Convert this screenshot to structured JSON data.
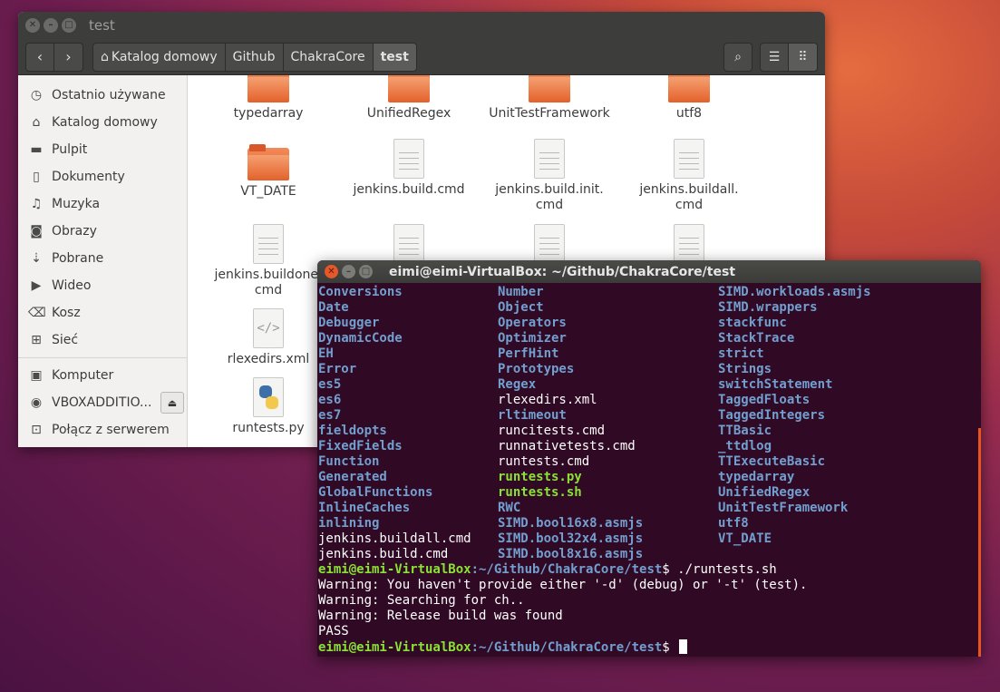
{
  "file_manager": {
    "title": "test",
    "breadcrumbs": [
      "Katalog domowy",
      "Github",
      "ChakraCore",
      "test"
    ],
    "sidebar": [
      {
        "label": "Ostatnio używane",
        "icon": "clock-icon"
      },
      {
        "label": "Katalog domowy",
        "icon": "home-icon"
      },
      {
        "label": "Pulpit",
        "icon": "folder-icon"
      },
      {
        "label": "Dokumenty",
        "icon": "document-icon"
      },
      {
        "label": "Muzyka",
        "icon": "music-icon"
      },
      {
        "label": "Obrazy",
        "icon": "camera-icon"
      },
      {
        "label": "Pobrane",
        "icon": "download-icon"
      },
      {
        "label": "Wideo",
        "icon": "video-icon"
      },
      {
        "label": "Kosz",
        "icon": "trash-icon"
      },
      {
        "label": "Sieć",
        "icon": "network-icon"
      },
      {
        "label": "Komputer",
        "icon": "computer-icon"
      },
      {
        "label": "VBOXADDITIO...",
        "icon": "disc-icon"
      },
      {
        "label": "Połącz z serwerem",
        "icon": "server-icon"
      }
    ],
    "files": [
      {
        "name": "typedarray",
        "type": "folder"
      },
      {
        "name": "UnifiedRegex",
        "type": "folder"
      },
      {
        "name": "UnitTestFramework",
        "type": "folder"
      },
      {
        "name": "utf8",
        "type": "folder"
      },
      {
        "name": "VT_DATE",
        "type": "folder"
      },
      {
        "name": "jenkins.build.cmd",
        "type": "text"
      },
      {
        "name": "jenkins.build.init.\ncmd",
        "type": "text"
      },
      {
        "name": "jenkins.buildall.\ncmd",
        "type": "text"
      },
      {
        "name": "jenkins.buildone.\ncmd",
        "type": "text"
      },
      {
        "name": "rlexedirs.xml",
        "type": "xml"
      },
      {
        "name": "runtests.py",
        "type": "python"
      }
    ]
  },
  "terminal": {
    "title": "eimi@eimi-VirtualBox: ~/Github/ChakraCore/test",
    "ls_columns": [
      [
        {
          "t": "Conversions",
          "k": "dir"
        },
        {
          "t": "Date",
          "k": "dir"
        },
        {
          "t": "Debugger",
          "k": "dir"
        },
        {
          "t": "DynamicCode",
          "k": "dir"
        },
        {
          "t": "EH",
          "k": "dir"
        },
        {
          "t": "Error",
          "k": "dir"
        },
        {
          "t": "es5",
          "k": "dir"
        },
        {
          "t": "es6",
          "k": "dir"
        },
        {
          "t": "es7",
          "k": "dir"
        },
        {
          "t": "fieldopts",
          "k": "dir"
        },
        {
          "t": "FixedFields",
          "k": "dir"
        },
        {
          "t": "Function",
          "k": "dir"
        },
        {
          "t": "Generated",
          "k": "dir"
        },
        {
          "t": "GlobalFunctions",
          "k": "dir"
        },
        {
          "t": "InlineCaches",
          "k": "dir"
        },
        {
          "t": "inlining",
          "k": "dir"
        },
        {
          "t": "jenkins.buildall.cmd",
          "k": "plain"
        },
        {
          "t": "jenkins.build.cmd",
          "k": "plain"
        }
      ],
      [
        {
          "t": "Number",
          "k": "dir"
        },
        {
          "t": "Object",
          "k": "dir"
        },
        {
          "t": "Operators",
          "k": "dir"
        },
        {
          "t": "Optimizer",
          "k": "dir"
        },
        {
          "t": "PerfHint",
          "k": "dir"
        },
        {
          "t": "Prototypes",
          "k": "dir"
        },
        {
          "t": "Regex",
          "k": "dir"
        },
        {
          "t": "rlexedirs.xml",
          "k": "plain"
        },
        {
          "t": "rltimeout",
          "k": "dir"
        },
        {
          "t": "runcitests.cmd",
          "k": "plain"
        },
        {
          "t": "runnativetests.cmd",
          "k": "plain"
        },
        {
          "t": "runtests.cmd",
          "k": "plain"
        },
        {
          "t": "runtests.py",
          "k": "exe"
        },
        {
          "t": "runtests.sh",
          "k": "exe"
        },
        {
          "t": "RWC",
          "k": "dir"
        },
        {
          "t": "SIMD.bool16x8.asmjs",
          "k": "dir"
        },
        {
          "t": "SIMD.bool32x4.asmjs",
          "k": "dir"
        },
        {
          "t": "SIMD.bool8x16.asmjs",
          "k": "dir"
        }
      ],
      [
        {
          "t": "SIMD.workloads.asmjs",
          "k": "dir"
        },
        {
          "t": "SIMD.wrappers",
          "k": "dir"
        },
        {
          "t": "stackfunc",
          "k": "dir"
        },
        {
          "t": "StackTrace",
          "k": "dir"
        },
        {
          "t": "strict",
          "k": "dir"
        },
        {
          "t": "Strings",
          "k": "dir"
        },
        {
          "t": "switchStatement",
          "k": "dir"
        },
        {
          "t": "TaggedFloats",
          "k": "dir"
        },
        {
          "t": "TaggedIntegers",
          "k": "dir"
        },
        {
          "t": "TTBasic",
          "k": "dir"
        },
        {
          "t": "_ttdlog",
          "k": "dir"
        },
        {
          "t": "TTExecuteBasic",
          "k": "dir"
        },
        {
          "t": "typedarray",
          "k": "dir"
        },
        {
          "t": "UnifiedRegex",
          "k": "dir"
        },
        {
          "t": "UnitTestFramework",
          "k": "dir"
        },
        {
          "t": "utf8",
          "k": "dir"
        },
        {
          "t": "VT_DATE",
          "k": "dir"
        },
        {
          "t": "",
          "k": "plain"
        }
      ]
    ],
    "prompt_user": "eimi@eimi-VirtualBox",
    "prompt_path": ":~/Github/ChakraCore/test",
    "prompt_symbol": "$ ",
    "command": "./runtests.sh",
    "output": [
      "Warning: You haven't provide either '-d' (debug) or '-t' (test).",
      "Warning: Searching for ch..",
      "Warning: Release build was found",
      "PASS"
    ]
  },
  "colors": {
    "dir": "#729fcf",
    "exe": "#8ae234",
    "terminal_bg": "#300a24",
    "accent": "#e95420"
  }
}
